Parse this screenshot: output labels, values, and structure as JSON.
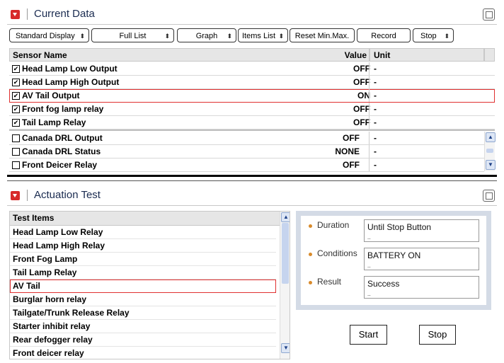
{
  "current_data": {
    "title": "Current Data",
    "toolbar": [
      {
        "label": "Standard Display",
        "has_spinner": true
      },
      {
        "label": "Full List",
        "has_spinner": true
      },
      {
        "label": "Graph",
        "has_spinner": true
      },
      {
        "label": "Items List",
        "has_spinner": true
      },
      {
        "label": "Reset Min.Max.",
        "has_spinner": false
      },
      {
        "label": "Record",
        "has_spinner": false
      },
      {
        "label": "Stop",
        "has_spinner": true
      }
    ],
    "spinner_glyph": "⬍",
    "columns": {
      "sensor": "Sensor Name",
      "value": "Value",
      "unit": "Unit"
    },
    "pinned_rows": [
      {
        "name": "Head Lamp Low Output",
        "value": "OFF",
        "unit": "-",
        "checked": true
      },
      {
        "name": "Head Lamp High Output",
        "value": "OFF",
        "unit": "-",
        "checked": true
      },
      {
        "name": "AV Tail Output",
        "value": "ON",
        "unit": "-",
        "checked": true
      },
      {
        "name": "Front fog lamp relay",
        "value": "OFF",
        "unit": "-",
        "checked": true
      },
      {
        "name": "Tail Lamp Relay",
        "value": "OFF",
        "unit": "-",
        "checked": true
      }
    ],
    "rows": [
      {
        "name": "Canada DRL Output",
        "value": "OFF",
        "unit": "-",
        "checked": false
      },
      {
        "name": "Canada DRL Status",
        "value": "NONE",
        "unit": "-",
        "checked": false
      },
      {
        "name": "Front Deicer Relay",
        "value": "OFF",
        "unit": "-",
        "checked": false
      }
    ],
    "selected_row": "AV Tail Output"
  },
  "actuation_test": {
    "title": "Actuation Test",
    "list_header": "Test Items",
    "items": [
      "Head Lamp Low Relay",
      "Head Lamp High Relay",
      "Front Fog Lamp",
      "Tail Lamp Relay",
      "AV Tail",
      "Burglar horn relay",
      "Tailgate/Trunk Release Relay",
      "Starter inhibit relay",
      "Rear defogger relay",
      "Front deicer relay"
    ],
    "selected_item": "AV Tail",
    "info": [
      {
        "label": "Duration",
        "value": "Until Stop Button"
      },
      {
        "label": "Conditions",
        "value": "BATTERY ON"
      },
      {
        "label": "Result",
        "value": "Success"
      }
    ],
    "overflow_marker": "..",
    "start_label": "Start",
    "stop_label": "Stop"
  },
  "colors": {
    "accent_red": "#d72a2a",
    "selection_outline": "#e03030",
    "title_text": "#1a2b50",
    "bullet": "#d98b2b"
  },
  "icons": {
    "collapse": "collapse-arrow-icon",
    "maximize": "maximize-window-icon",
    "check": "✔"
  }
}
